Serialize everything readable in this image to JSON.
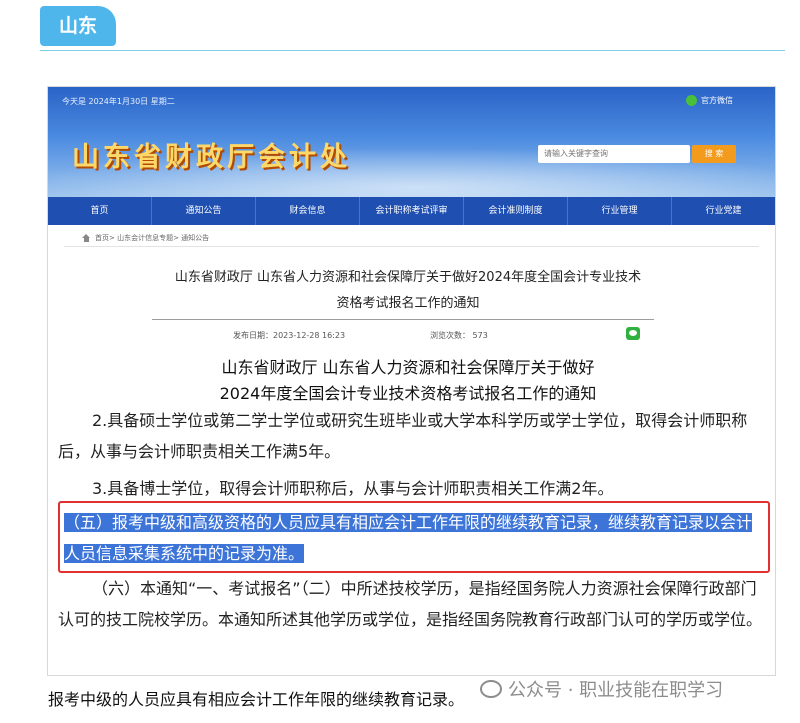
{
  "province_tag": "山东",
  "site": {
    "date_text": "今天是 2024年1月30日 星期二",
    "wechat_label": "官方微信",
    "logo_text": "山东省财政厅会计处",
    "search_placeholder": "请输入关键字查询",
    "search_button": "搜 索"
  },
  "nav": {
    "items": [
      "首页",
      "通知公告",
      "财会信息",
      "会计职称考试评审",
      "会计准则制度",
      "行业管理",
      "行业党建"
    ]
  },
  "breadcrumb": "首页> 山东会计信息专题> 通知公告",
  "article": {
    "title_line1": "山东省财政厅 山东省人力资源和社会保障厅关于做好2024年度全国会计专业技术",
    "title_line2": "资格考试报名工作的通知",
    "publish_date": "发布日期：2023-12-28 16:23",
    "views": "浏览次数： 573",
    "heading_line1": "山东省财政厅  山东省人力资源和社会保障厅关于做好",
    "heading_line2": "2024年度全国会计专业技术资格考试报名工作的通知",
    "p2": "2.具备硕士学位或第二学士学位或研究生班毕业或大学本科学历或学士学位，取得会计师职称后，从事与会计师职责相关工作满5年。",
    "p3": "3.具备博士学位，取得会计师职称后，从事与会计师职责相关工作满2年。",
    "p5_highlight": "（五）报考中级和高级资格的人员应具有相应会计工作年限的继续教育记录，继续教育记录以会计人员信息采集系统中的记录为准。",
    "p6": "（六）本通知“一、考试报名”（二）中所述技校学历，是指经国务院人力资源社会保障行政部门认可的技工院校学历。本通知所述其他学历或学位，是指经国务院教育行政部门认可的学历或学位。"
  },
  "caption": "报考中级的人员应具有相应会计工作年限的继续教育记录。",
  "watermark": "公众号 · 职业技能在职学习"
}
